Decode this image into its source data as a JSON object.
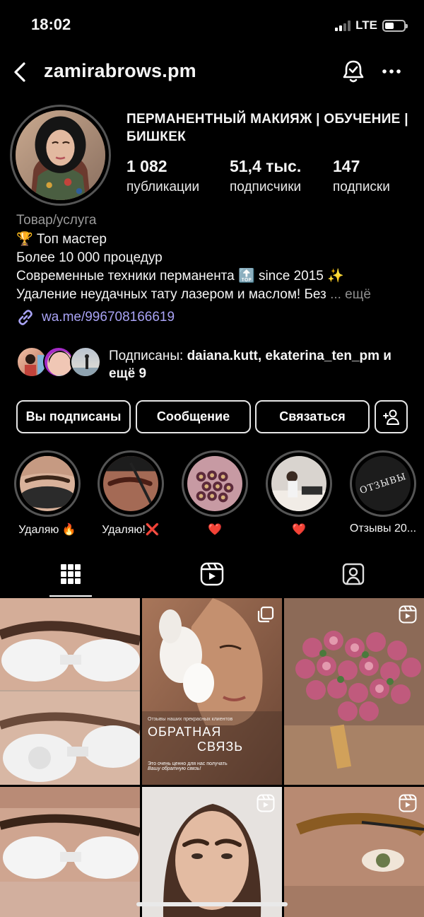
{
  "status_bar": {
    "time": "18:02",
    "network": "LTE"
  },
  "header": {
    "username": "zamirabrows.pm"
  },
  "profile": {
    "name": "ПЕРМАНЕНТНЫЙ МАКИЯЖ | ОБУЧЕНИЕ | БИШКЕК",
    "stats": [
      {
        "value": "1 082",
        "label": "публикации"
      },
      {
        "value": "51,4 тыс.",
        "label": "подписчики"
      },
      {
        "value": "147",
        "label": "подписки"
      }
    ],
    "category": "Товар/услуга",
    "bio_lines": [
      "🏆 Топ мастер",
      "Более 10 000 процедур",
      "Современные техники перманента 🔝 since 2015 ✨",
      "Удаление неудачных тату лазером и маслом! Без"
    ],
    "bio_more": "... ещё",
    "link": "wa.me/996708166619"
  },
  "followed_by": {
    "prefix": "Подписаны:",
    "users": "daiana.kutt, ekaterina_ten_pm",
    "suffix": "и ещё 9"
  },
  "actions": {
    "following": "Вы подписаны",
    "message": "Сообщение",
    "contact": "Связаться"
  },
  "highlights": [
    {
      "label": "Удаляю 🔥",
      "icon": "highlight-eyebrow-photo"
    },
    {
      "label": "Удаляю!❌",
      "icon": "highlight-eyebrow-work-photo"
    },
    {
      "label": "❤️",
      "icon": "highlight-flowers-photo"
    },
    {
      "label": "❤️",
      "icon": "highlight-salon-photo"
    },
    {
      "label": "Отзывы 20...",
      "icon": "highlight-reviews-logo"
    }
  ],
  "highlight_logo_text": "ОТЗЫВЫ",
  "tabs": [
    "grid-icon",
    "reels-icon",
    "tagged-icon"
  ],
  "posts": [
    {
      "type": "photo",
      "icon": "none"
    },
    {
      "type": "carousel",
      "icon": "carousel-icon",
      "overlay": {
        "sub": "Отзывы наших прекрасных клиентов",
        "title1": "ОБРАТНАЯ",
        "title2": "СВЯЗЬ",
        "body1": "Это очень ценно для нас получать",
        "body2": "Вашу обратную связь!"
      }
    },
    {
      "type": "reel",
      "icon": "reels-icon"
    },
    {
      "type": "photo",
      "icon": "none"
    },
    {
      "type": "reel",
      "icon": "reels-icon"
    },
    {
      "type": "reel",
      "icon": "reels-icon"
    }
  ],
  "colors": {
    "background": "#000000",
    "link": "#a9a3f5",
    "secondary_text": "#9a9a9a",
    "like_red": "#e0162b"
  }
}
